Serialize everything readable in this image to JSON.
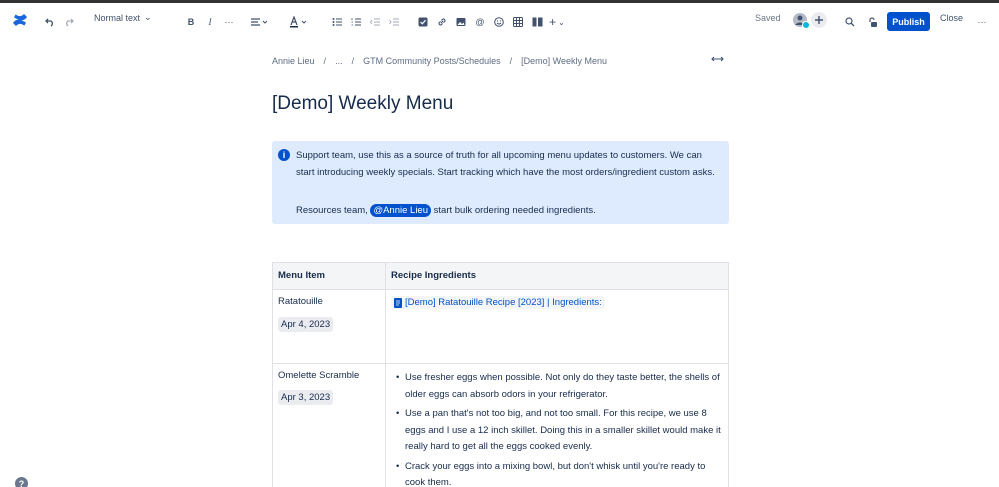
{
  "toolbar": {
    "text_style": "Normal text",
    "saved_label": "Saved",
    "publish_label": "Publish",
    "close_label": "Close",
    "more_label": "···",
    "insert_plus": "+"
  },
  "breadcrumb": {
    "items": [
      "Annie Lieu",
      "...",
      "GTM Community Posts/Schedules",
      "[Demo] Weekly Menu"
    ],
    "separator": "/"
  },
  "page": {
    "title": "[Demo] Weekly Menu"
  },
  "info_panel": {
    "text": "Support team, use this as a source of truth for all upcoming menu updates to customers. We can start introducing weekly specials. Start tracking which have the most orders/ingredient custom asks.",
    "line2_prefix": "Resources team,",
    "mention": "@Annie Lieu",
    "line2_suffix": "start bulk ordering needed ingredients."
  },
  "table": {
    "headers": [
      "Menu Item",
      "Recipe Ingredients"
    ],
    "rows": [
      {
        "item": "Ratatouille",
        "date": "Apr 4, 2023",
        "link": "[Demo] Ratatouille Recipe [2023] | Ingredients:"
      },
      {
        "item": "Omelette Scramble",
        "date": "Apr 3, 2023",
        "bullets": [
          "Use fresher eggs when possible.  Not only do they taste better, the shells of older eggs can absorb odors in your refrigerator.",
          "Use a pan that's not too big, and not too small.  For this recipe, we use 8 eggs and I use a 12 inch skillet.  Doing this in a smaller skillet would make it really hard to get all the eggs cooked evenly.",
          "Crack your eggs into a mixing bowl, but don't whisk until you're ready to cook them."
        ]
      }
    ]
  },
  "colors": {
    "accent": "#0052cc",
    "info_bg": "#deebff",
    "header_bg": "#f4f5f7"
  }
}
